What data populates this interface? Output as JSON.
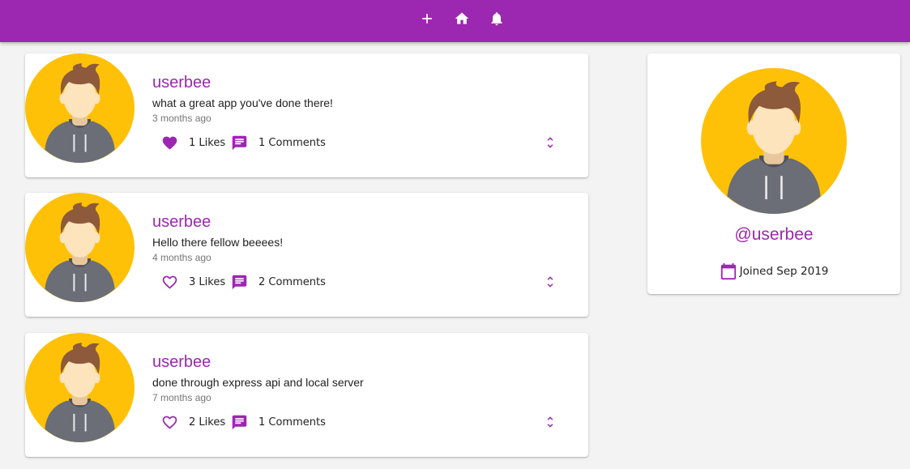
{
  "header": {
    "nav": [
      {
        "name": "add-post-icon"
      },
      {
        "name": "home-icon"
      },
      {
        "name": "notifications-icon"
      }
    ],
    "accent": "#9c27b0"
  },
  "posts": [
    {
      "username": "userbee",
      "body": "what a great app you've done there!",
      "time": "3 months ago",
      "likes": "1 Likes",
      "comments": "1 Comments",
      "liked": true
    },
    {
      "username": "userbee",
      "body": "Hello there fellow beeees!",
      "time": "4 months ago",
      "likes": "3 Likes",
      "comments": "2 Comments",
      "liked": false
    },
    {
      "username": "userbee",
      "body": "done through express api and local server",
      "time": "7 months ago",
      "likes": "2 Likes",
      "comments": "1 Comments",
      "liked": false
    }
  ],
  "profile": {
    "handle": "@userbee",
    "joined": "Joined Sep 2019"
  }
}
